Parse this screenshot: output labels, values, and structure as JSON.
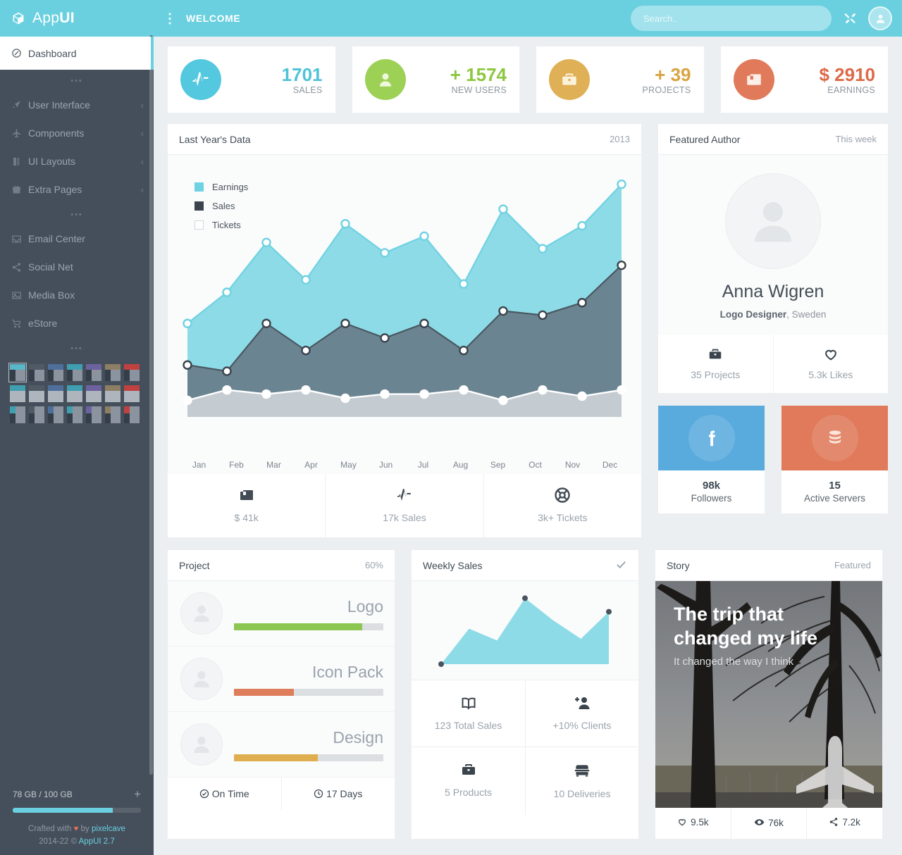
{
  "brand": {
    "name_light": "App",
    "name_bold": "UI",
    "logo_icon": "cube-icon"
  },
  "header": {
    "menu_icon": "vertical-dots-icon",
    "title": "WELCOME",
    "search": {
      "placeholder": "Search..",
      "value": ""
    },
    "tools_icon": "wrench-screwdriver-icon",
    "avatar_icon": "user-avatar-icon"
  },
  "sidebar": {
    "items": [
      {
        "label": "Dashboard",
        "icon": "compass-icon",
        "active": true,
        "chevron": ""
      },
      {
        "label": "User Interface",
        "icon": "rocket-icon",
        "active": false,
        "chevron": "‹"
      },
      {
        "label": "Components",
        "icon": "plane-icon",
        "active": false,
        "chevron": "‹"
      },
      {
        "label": "UI Layouts",
        "icon": "book-icon",
        "active": false,
        "chevron": "‹"
      },
      {
        "label": "Extra Pages",
        "icon": "gift-icon",
        "active": false,
        "chevron": "‹"
      },
      {
        "label": "Email Center",
        "icon": "inbox-icon",
        "active": false,
        "chevron": ""
      },
      {
        "label": "Social Net",
        "icon": "share-icon",
        "active": false,
        "chevron": ""
      },
      {
        "label": "Media Box",
        "icon": "image-icon",
        "active": false,
        "chevron": ""
      },
      {
        "label": "eStore",
        "icon": "cart-icon",
        "active": false,
        "chevron": ""
      }
    ],
    "separator": "•••",
    "theme_swatches": [
      "#58b7c9",
      "#4f5a64",
      "#4e6f9c",
      "#3f9fb0",
      "#6d62a0",
      "#8e7e64",
      "#c0413f"
    ],
    "storage": {
      "label": "78 GB / 100 GB",
      "add_icon": "plus-icon",
      "percent": 78
    },
    "footer": {
      "crafted_prefix": "Crafted with",
      "heart": "♥",
      "crafted_by": "by",
      "author": "pixelcave",
      "copyright": "2014-22 ©",
      "version": "AppUI 2.7"
    }
  },
  "stats": [
    {
      "value": "1701",
      "label": "SALES",
      "icon": "pulse-icon",
      "color": "#54c8de",
      "value_color": "#4fc3d8"
    },
    {
      "value": "+ 1574",
      "label": "NEW USERS",
      "icon": "user-icon",
      "color": "#9dd155",
      "value_color": "#8dc63f"
    },
    {
      "value": "+ 39",
      "label": "PROJECTS",
      "icon": "briefcase-icon",
      "color": "#dfb055",
      "value_color": "#d9a441"
    },
    {
      "value": "$ 2910",
      "label": "EARNINGS",
      "icon": "archive-icon",
      "color": "#e07a5a",
      "value_color": "#dc6a48"
    }
  ],
  "chart_card": {
    "title": "Last Year's Data",
    "subtitle": "2013",
    "stats": [
      {
        "label": "$ 41k",
        "icon": "archive-icon"
      },
      {
        "label": "17k Sales",
        "icon": "pulse-icon"
      },
      {
        "label": "3k+ Tickets",
        "icon": "lifebuoy-icon"
      }
    ]
  },
  "chart_data": {
    "type": "area",
    "title": "Last Year's Data",
    "subtitle": "2013",
    "categories": [
      "Jan",
      "Feb",
      "Mar",
      "Apr",
      "May",
      "Jun",
      "Jul",
      "Aug",
      "Sep",
      "Oct",
      "Nov",
      "Dec"
    ],
    "series": [
      {
        "name": "Earnings",
        "color": "#8ddbe6",
        "checked": true,
        "values": [
          45,
          60,
          84,
          66,
          93,
          79,
          87,
          64,
          100,
          81,
          92,
          112
        ]
      },
      {
        "name": "Sales",
        "color": "#3b444d",
        "area_color": "#6a8491",
        "checked": true,
        "values": [
          25,
          22,
          45,
          32,
          45,
          38,
          45,
          32,
          51,
          49,
          55,
          73
        ]
      },
      {
        "name": "Tickets",
        "color": "#ffffff",
        "area_color": "#c5ccd1",
        "checked": false,
        "values": [
          8,
          13,
          11,
          13,
          9,
          11,
          11,
          13,
          8,
          13,
          10,
          13
        ]
      }
    ],
    "ylim": [
      0,
      120
    ],
    "grid": false,
    "legend": "top-left"
  },
  "author": {
    "title": "Featured Author",
    "subtitle": "This week",
    "avatar_icon": "user-avatar-icon",
    "name": "Anna Wigren",
    "role": "Logo Designer",
    "location": ", Sweden",
    "stats": [
      {
        "label": "35 Projects",
        "icon": "briefcase-icon"
      },
      {
        "label": "5.3k Likes",
        "icon": "heart-icon"
      }
    ]
  },
  "mini_cards": [
    {
      "icon": "facebook-icon",
      "color": "#5aabdd",
      "number": "98k",
      "label": "Followers"
    },
    {
      "icon": "database-icon",
      "color": "#e07a5a",
      "number": "15",
      "label": "Active Servers"
    }
  ],
  "project": {
    "title": "Project",
    "subtitle": "60%",
    "rows": [
      {
        "name": "Logo",
        "avatar_icon": "user-avatar-icon",
        "percent": 86,
        "color": "#8cc751"
      },
      {
        "name": "Icon Pack",
        "avatar_icon": "user-avatar-icon",
        "percent": 40,
        "color": "#dd7d5b"
      },
      {
        "name": "Design",
        "avatar_icon": "user-avatar-icon",
        "percent": 56,
        "color": "#dfae4e"
      }
    ],
    "footer": [
      {
        "label": "On Time",
        "icon": "check-circle-icon"
      },
      {
        "label": "17 Days",
        "icon": "clock-icon"
      }
    ]
  },
  "weekly": {
    "title": "Weekly Sales",
    "check_icon": "check-icon",
    "chart": {
      "type": "area",
      "color": "#8ddbe6",
      "values": [
        0,
        42,
        28,
        78,
        52,
        30,
        62
      ],
      "marker_points": [
        0,
        3,
        6
      ],
      "marker_color": "#4a545e"
    },
    "cells": [
      {
        "label": "123 Total Sales",
        "icon": "book-icon"
      },
      {
        "label": "+10% Clients",
        "icon": "user-plus-icon"
      },
      {
        "label": "5 Products",
        "icon": "briefcase-icon"
      },
      {
        "label": "10 Deliveries",
        "icon": "truck-icon"
      }
    ]
  },
  "story": {
    "title": "Story",
    "subtitle": "Featured",
    "headline": "The trip that changed my life",
    "tagline": "It changed the way I think",
    "image_icon": "airplane-icon",
    "footer": [
      {
        "label": "9.5k",
        "icon": "heart-icon"
      },
      {
        "label": "76k",
        "icon": "eye-icon"
      },
      {
        "label": "7.2k",
        "icon": "share-icon"
      }
    ]
  }
}
